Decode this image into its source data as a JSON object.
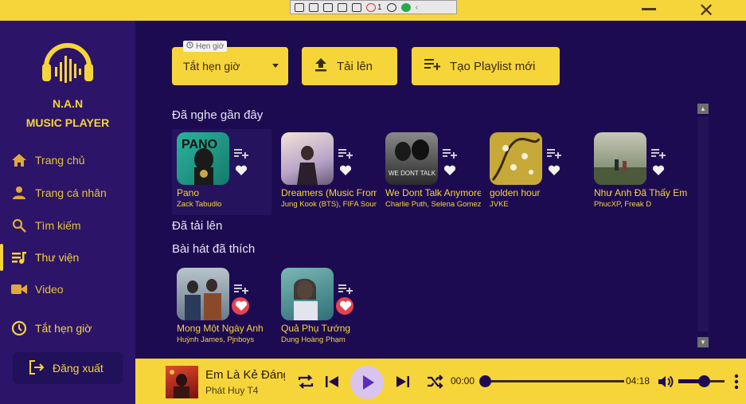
{
  "brand": {
    "line1": "N.A.N",
    "line2": "MUSIC PLAYER"
  },
  "nav": [
    {
      "label": "Trang chủ",
      "icon": "home-icon"
    },
    {
      "label": "Trang cá nhân",
      "icon": "person-icon"
    },
    {
      "label": "Tìm kiếm",
      "icon": "search-icon"
    },
    {
      "label": "Thư viện",
      "icon": "library-icon",
      "active": true
    },
    {
      "label": "Video",
      "icon": "video-icon"
    },
    {
      "label": "Tắt hẹn giờ",
      "icon": "clock-icon"
    }
  ],
  "logout_label": "Đăng xuất",
  "toolbar": {
    "timer_hint": "Hẹn giờ",
    "timer_value": "Tắt hẹn giờ",
    "upload_label": "Tải lên",
    "new_playlist_label": "Tạo Playlist mới"
  },
  "sections": {
    "recent": "Đã nghe gần đây",
    "uploaded": "Đã tải lên",
    "liked": "Bài hát đã thích"
  },
  "recent_songs": [
    {
      "title": "Pano",
      "artist": "Zack Tabudlo"
    },
    {
      "title": "Dreamers (Music From",
      "artist": "Jung Kook (BTS), FIFA Sound"
    },
    {
      "title": "We Dont Talk Anymore",
      "artist": "Charlie Puth, Selena Gomez"
    },
    {
      "title": "golden hour",
      "artist": "JVKE"
    },
    {
      "title": "Như Anh Đã Thấy Em",
      "artist": "PhucXP, Freak D"
    }
  ],
  "liked_songs": [
    {
      "title": "Mong Một Ngày Anh",
      "artist": "Huỳnh James, Pjnboys"
    },
    {
      "title": "Quả Phụ Tướng",
      "artist": "Dung Hoàng Phạm"
    }
  ],
  "player": {
    "title": "Em Là Kẻ Đáng",
    "artist": "Phát Huy T4",
    "current_time": "00:00",
    "total_time": "04:18",
    "progress": 0,
    "volume": 0.55
  },
  "recorder_toolbar": {
    "count": "1"
  },
  "colors": {
    "accent": "#f6d53a",
    "sidebar": "#2c1468",
    "main": "#1d0b52",
    "heart": "#e8414f"
  }
}
